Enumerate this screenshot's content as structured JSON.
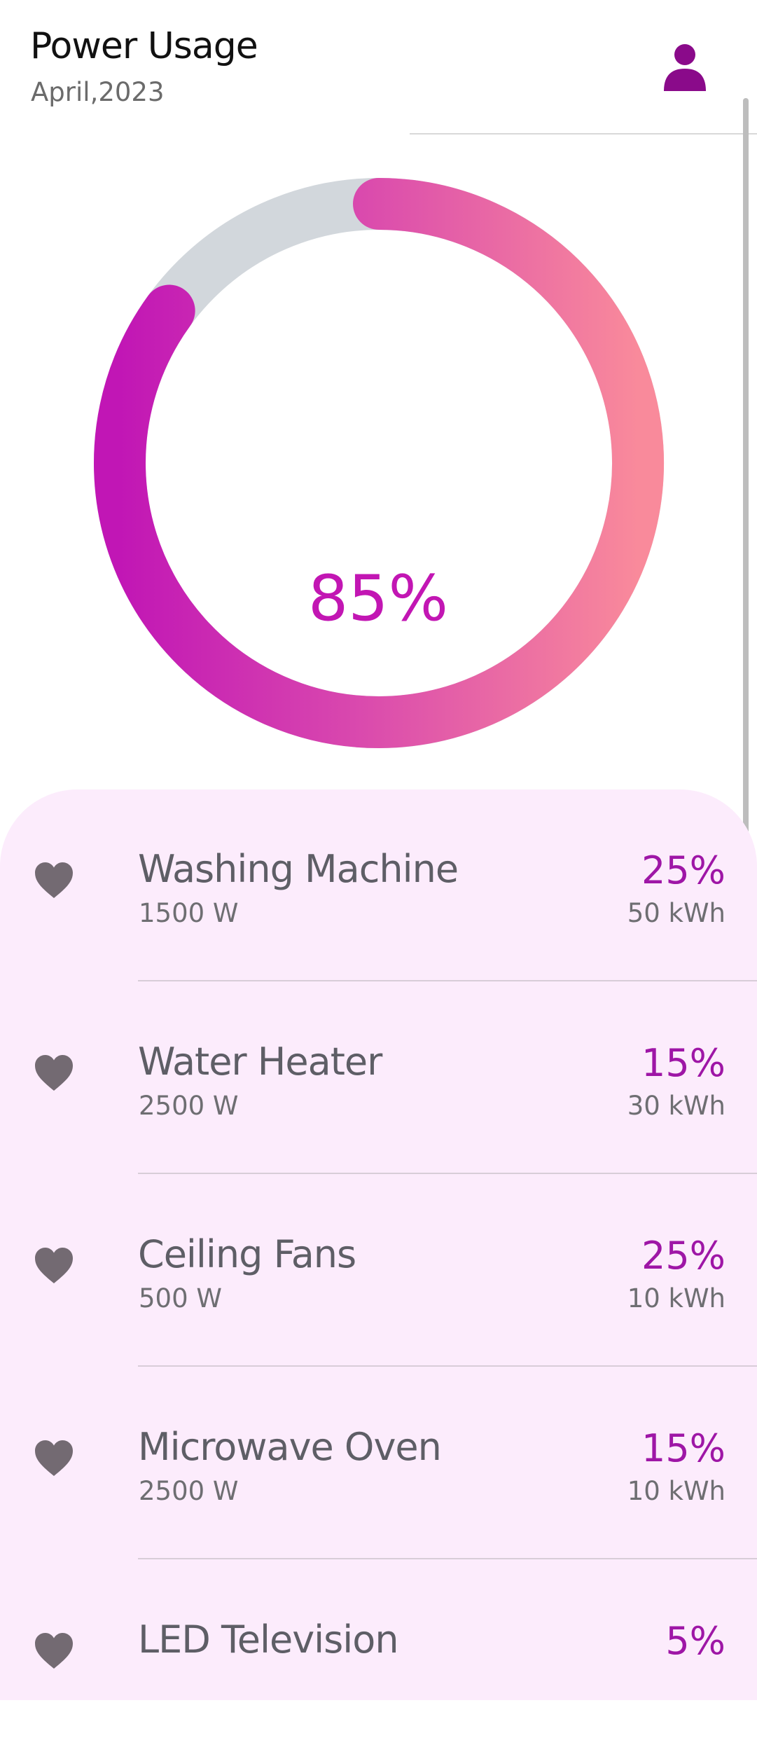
{
  "header": {
    "title": "Power Usage",
    "subtitle": "April,2023",
    "profile_icon": "person-icon"
  },
  "gauge": {
    "value_label": "85%",
    "fill_fraction": 0.85,
    "gradient_colors": [
      "#c116b5",
      "#d948ae",
      "#f98a9b"
    ],
    "track_color": "#d2d7dc"
  },
  "colors": {
    "accent": "#c216b3",
    "percent_text": "#9e16a6",
    "list_background": "#fcecfc",
    "profile_icon": "#8a0a8a",
    "heart_icon": "#736a72"
  },
  "appliances": [
    {
      "name": "Washing Machine",
      "watts": "1500 W",
      "percent": "25%",
      "energy": "50 kWh",
      "icon": "heart-icon"
    },
    {
      "name": "Water Heater",
      "watts": "2500 W",
      "percent": "15%",
      "energy": "30 kWh",
      "icon": "heart-icon"
    },
    {
      "name": "Ceiling Fans",
      "watts": "500 W",
      "percent": "25%",
      "energy": "10 kWh",
      "icon": "heart-icon"
    },
    {
      "name": "Microwave Oven",
      "watts": "2500 W",
      "percent": "15%",
      "energy": "10 kWh",
      "icon": "heart-icon"
    },
    {
      "name": "LED Television",
      "watts": "",
      "percent": "5%",
      "energy": "",
      "icon": "heart-icon"
    }
  ]
}
